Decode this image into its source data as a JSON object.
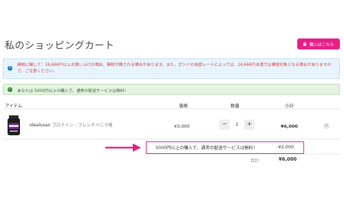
{
  "page": {
    "title": "私のショッピングカート",
    "buy_button": "購入はこちら"
  },
  "alerts": {
    "info": "関税に関して：16,666円以上お買い上げの場合、関税が課される場合があります。また、ポンドの為替レートによっては、16,666円未満でも課税対象となる場合がありますので、ご注意ください。",
    "success_prefix": "あなたは",
    "success_text": "5000円以上の購入で、通常の配送サービスは無料！"
  },
  "table": {
    "headers": {
      "item": "アイテム",
      "price": "価格",
      "qty": "数量",
      "subtotal": "小計"
    }
  },
  "cart": {
    "items": [
      {
        "brand_name": "IdealLean",
        "variant": "プロテイン - フレンチバニラ味",
        "price": "¥3,000",
        "qty": "2",
        "line_total": "¥6,000"
      }
    ],
    "qty_minus": "−",
    "qty_plus": "+",
    "remove": "×"
  },
  "discount": {
    "label": "5000円以上の購入で、通常の配送サービスは無料！",
    "value": "-¥2,000"
  },
  "totals": {
    "label": "合計:",
    "value": "¥6,000"
  },
  "colors": {
    "accent": "#e81f88",
    "info_text": "#d83c3c",
    "success_text": "#2c6b22"
  }
}
